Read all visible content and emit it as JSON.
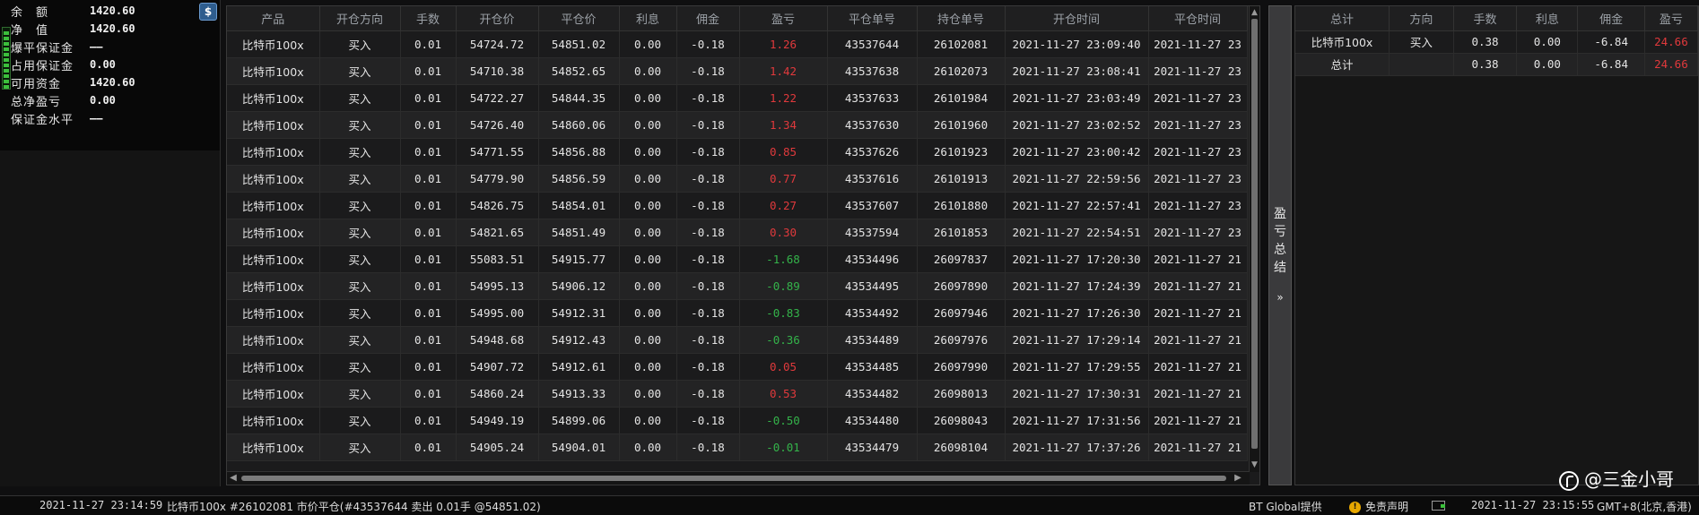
{
  "account": {
    "rows": [
      {
        "label": "余　额",
        "value": "1420.60"
      },
      {
        "label": "净　值",
        "value": "1420.60"
      },
      {
        "label": "爆平保证金",
        "value": "——"
      },
      {
        "label": "占用保证金",
        "value": "0.00"
      },
      {
        "label": "可用资金",
        "value": "1420.60"
      },
      {
        "label": "总净盈亏",
        "value": "0.00"
      },
      {
        "label": "保证金水平",
        "value": "——"
      }
    ],
    "dollar_button_label": "$"
  },
  "table": {
    "headers": [
      "产品",
      "开仓方向",
      "手数",
      "开仓价",
      "平仓价",
      "利息",
      "佣金",
      "盈亏",
      "平仓单号",
      "持仓单号",
      "开仓时间",
      "平仓时间"
    ],
    "rows": [
      {
        "product": "比特币100x",
        "dir": "买入",
        "lots": "0.01",
        "open": "54724.72",
        "close": "54851.02",
        "interest": "0.00",
        "commission": "-0.18",
        "pl": "1.26",
        "close_id": "43537644",
        "pos_id": "26102081",
        "open_time": "2021-11-27 23:09:40",
        "close_time": "2021-11-27 23"
      },
      {
        "product": "比特币100x",
        "dir": "买入",
        "lots": "0.01",
        "open": "54710.38",
        "close": "54852.65",
        "interest": "0.00",
        "commission": "-0.18",
        "pl": "1.42",
        "close_id": "43537638",
        "pos_id": "26102073",
        "open_time": "2021-11-27 23:08:41",
        "close_time": "2021-11-27 23"
      },
      {
        "product": "比特币100x",
        "dir": "买入",
        "lots": "0.01",
        "open": "54722.27",
        "close": "54844.35",
        "interest": "0.00",
        "commission": "-0.18",
        "pl": "1.22",
        "close_id": "43537633",
        "pos_id": "26101984",
        "open_time": "2021-11-27 23:03:49",
        "close_time": "2021-11-27 23"
      },
      {
        "product": "比特币100x",
        "dir": "买入",
        "lots": "0.01",
        "open": "54726.40",
        "close": "54860.06",
        "interest": "0.00",
        "commission": "-0.18",
        "pl": "1.34",
        "close_id": "43537630",
        "pos_id": "26101960",
        "open_time": "2021-11-27 23:02:52",
        "close_time": "2021-11-27 23"
      },
      {
        "product": "比特币100x",
        "dir": "买入",
        "lots": "0.01",
        "open": "54771.55",
        "close": "54856.88",
        "interest": "0.00",
        "commission": "-0.18",
        "pl": "0.85",
        "close_id": "43537626",
        "pos_id": "26101923",
        "open_time": "2021-11-27 23:00:42",
        "close_time": "2021-11-27 23"
      },
      {
        "product": "比特币100x",
        "dir": "买入",
        "lots": "0.01",
        "open": "54779.90",
        "close": "54856.59",
        "interest": "0.00",
        "commission": "-0.18",
        "pl": "0.77",
        "close_id": "43537616",
        "pos_id": "26101913",
        "open_time": "2021-11-27 22:59:56",
        "close_time": "2021-11-27 23"
      },
      {
        "product": "比特币100x",
        "dir": "买入",
        "lots": "0.01",
        "open": "54826.75",
        "close": "54854.01",
        "interest": "0.00",
        "commission": "-0.18",
        "pl": "0.27",
        "close_id": "43537607",
        "pos_id": "26101880",
        "open_time": "2021-11-27 22:57:41",
        "close_time": "2021-11-27 23"
      },
      {
        "product": "比特币100x",
        "dir": "买入",
        "lots": "0.01",
        "open": "54821.65",
        "close": "54851.49",
        "interest": "0.00",
        "commission": "-0.18",
        "pl": "0.30",
        "close_id": "43537594",
        "pos_id": "26101853",
        "open_time": "2021-11-27 22:54:51",
        "close_time": "2021-11-27 23"
      },
      {
        "product": "比特币100x",
        "dir": "买入",
        "lots": "0.01",
        "open": "55083.51",
        "close": "54915.77",
        "interest": "0.00",
        "commission": "-0.18",
        "pl": "-1.68",
        "close_id": "43534496",
        "pos_id": "26097837",
        "open_time": "2021-11-27 17:20:30",
        "close_time": "2021-11-27 21"
      },
      {
        "product": "比特币100x",
        "dir": "买入",
        "lots": "0.01",
        "open": "54995.13",
        "close": "54906.12",
        "interest": "0.00",
        "commission": "-0.18",
        "pl": "-0.89",
        "close_id": "43534495",
        "pos_id": "26097890",
        "open_time": "2021-11-27 17:24:39",
        "close_time": "2021-11-27 21"
      },
      {
        "product": "比特币100x",
        "dir": "买入",
        "lots": "0.01",
        "open": "54995.00",
        "close": "54912.31",
        "interest": "0.00",
        "commission": "-0.18",
        "pl": "-0.83",
        "close_id": "43534492",
        "pos_id": "26097946",
        "open_time": "2021-11-27 17:26:30",
        "close_time": "2021-11-27 21"
      },
      {
        "product": "比特币100x",
        "dir": "买入",
        "lots": "0.01",
        "open": "54948.68",
        "close": "54912.43",
        "interest": "0.00",
        "commission": "-0.18",
        "pl": "-0.36",
        "close_id": "43534489",
        "pos_id": "26097976",
        "open_time": "2021-11-27 17:29:14",
        "close_time": "2021-11-27 21"
      },
      {
        "product": "比特币100x",
        "dir": "买入",
        "lots": "0.01",
        "open": "54907.72",
        "close": "54912.61",
        "interest": "0.00",
        "commission": "-0.18",
        "pl": "0.05",
        "close_id": "43534485",
        "pos_id": "26097990",
        "open_time": "2021-11-27 17:29:55",
        "close_time": "2021-11-27 21"
      },
      {
        "product": "比特币100x",
        "dir": "买入",
        "lots": "0.01",
        "open": "54860.24",
        "close": "54913.33",
        "interest": "0.00",
        "commission": "-0.18",
        "pl": "0.53",
        "close_id": "43534482",
        "pos_id": "26098013",
        "open_time": "2021-11-27 17:30:31",
        "close_time": "2021-11-27 21"
      },
      {
        "product": "比特币100x",
        "dir": "买入",
        "lots": "0.01",
        "open": "54949.19",
        "close": "54899.06",
        "interest": "0.00",
        "commission": "-0.18",
        "pl": "-0.50",
        "close_id": "43534480",
        "pos_id": "26098043",
        "open_time": "2021-11-27 17:31:56",
        "close_time": "2021-11-27 21"
      },
      {
        "product": "比特币100x",
        "dir": "买入",
        "lots": "0.01",
        "open": "54905.24",
        "close": "54904.01",
        "interest": "0.00",
        "commission": "-0.18",
        "pl": "-0.01",
        "close_id": "43534479",
        "pos_id": "26098104",
        "open_time": "2021-11-27 17:37:26",
        "close_time": "2021-11-27 21"
      }
    ]
  },
  "pl_tab": {
    "label": "盈亏总结"
  },
  "summary": {
    "headers": [
      "总计",
      "方向",
      "手数",
      "利息",
      "佣金",
      "盈亏"
    ],
    "rows": [
      {
        "name": "比特币100x",
        "dir": "买入",
        "lots": "0.38",
        "interest": "0.00",
        "commission": "-6.84",
        "pl": "24.66"
      },
      {
        "name": "总计",
        "dir": "",
        "lots": "0.38",
        "interest": "0.00",
        "commission": "-6.84",
        "pl": "24.66"
      }
    ]
  },
  "status_bar": {
    "left_time": "2021-11-27 23:14:59",
    "message": "比特币100x #26102081 市价平仓(#43537644 卖出 0.01手 @54851.02)",
    "provider": "BT Global提供",
    "disclaimer": "免责声明",
    "right_time": "2021-11-27 23:15:55",
    "timezone": "GMT+8(北京,香港)"
  },
  "watermark": "@三金小哥",
  "colors": {
    "profit": "#e0393c",
    "loss": "#34b34a"
  }
}
